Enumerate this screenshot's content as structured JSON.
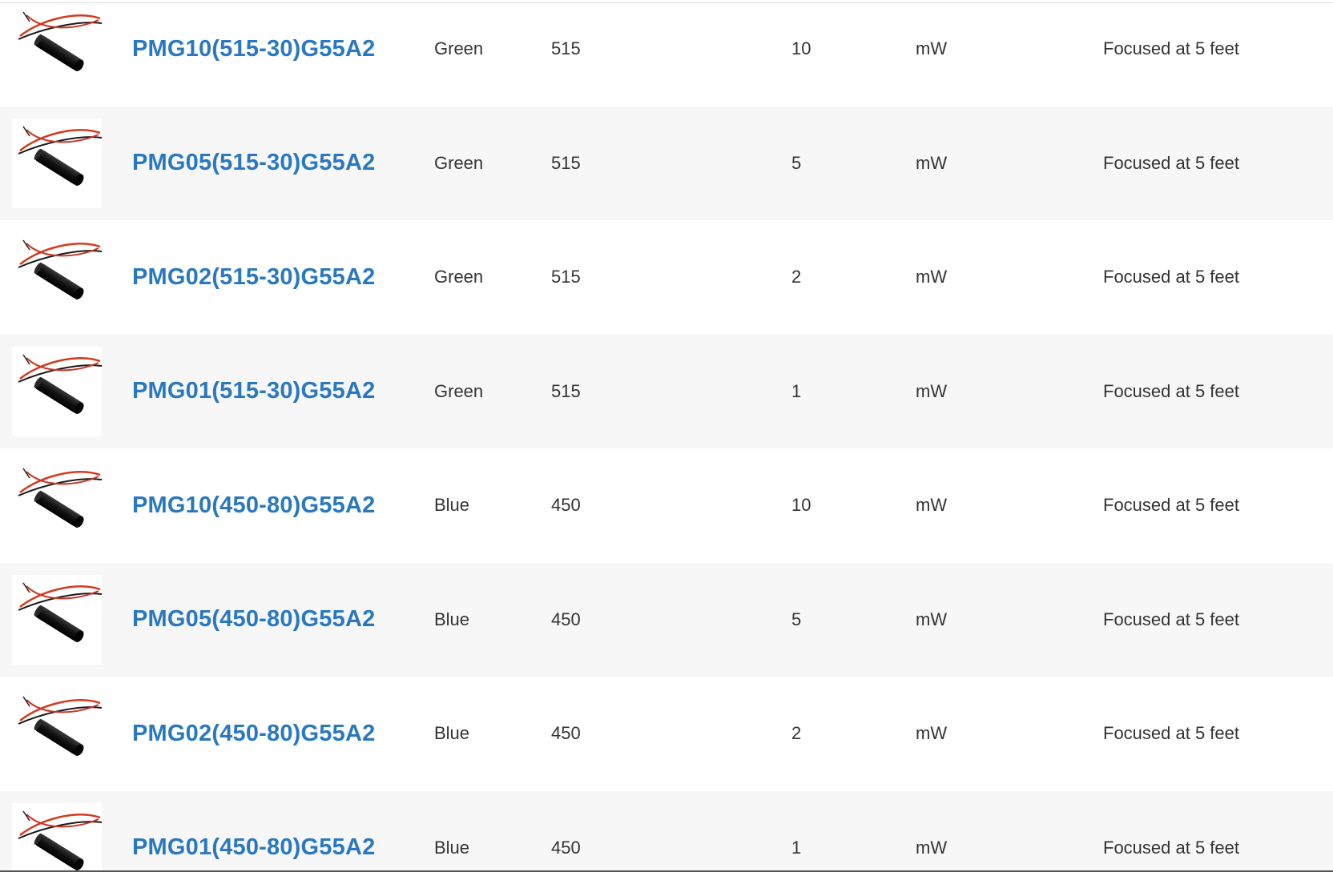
{
  "rows": [
    {
      "part": "PMG10(515-30)G55A2",
      "color": "Green",
      "wavelength": "515",
      "power": "10",
      "unit": "mW",
      "focus": "Focused at 5 feet",
      "image_icon": "laser-module-icon"
    },
    {
      "part": "PMG05(515-30)G55A2",
      "color": "Green",
      "wavelength": "515",
      "power": "5",
      "unit": "mW",
      "focus": "Focused at 5 feet",
      "image_icon": "laser-module-icon"
    },
    {
      "part": "PMG02(515-30)G55A2",
      "color": "Green",
      "wavelength": "515",
      "power": "2",
      "unit": "mW",
      "focus": "Focused at 5 feet",
      "image_icon": "laser-module-icon"
    },
    {
      "part": "PMG01(515-30)G55A2",
      "color": "Green",
      "wavelength": "515",
      "power": "1",
      "unit": "mW",
      "focus": "Focused at 5 feet",
      "image_icon": "laser-module-icon"
    },
    {
      "part": "PMG10(450-80)G55A2",
      "color": "Blue",
      "wavelength": "450",
      "power": "10",
      "unit": "mW",
      "focus": "Focused at 5 feet",
      "image_icon": "laser-module-icon"
    },
    {
      "part": "PMG05(450-80)G55A2",
      "color": "Blue",
      "wavelength": "450",
      "power": "5",
      "unit": "mW",
      "focus": "Focused at 5 feet",
      "image_icon": "laser-module-icon"
    },
    {
      "part": "PMG02(450-80)G55A2",
      "color": "Blue",
      "wavelength": "450",
      "power": "2",
      "unit": "mW",
      "focus": "Focused at 5 feet",
      "image_icon": "laser-module-icon"
    },
    {
      "part": "PMG01(450-80)G55A2",
      "color": "Blue",
      "wavelength": "450",
      "power": "1",
      "unit": "mW",
      "focus": "Focused at 5 feet",
      "image_icon": "laser-module-icon"
    }
  ],
  "colors": {
    "link": "#2a78c0",
    "text": "#333333",
    "row_alt": "#f7f7f7"
  }
}
